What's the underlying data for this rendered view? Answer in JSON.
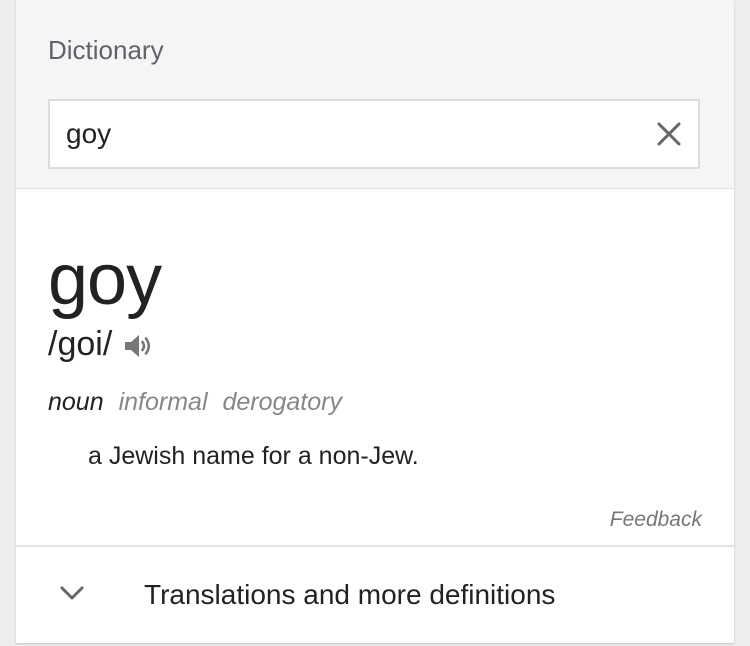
{
  "header": {
    "title": "Dictionary"
  },
  "search": {
    "value": "goy",
    "clear_icon": "close-icon"
  },
  "entry": {
    "word": "goy",
    "phonetic": "/goi/",
    "audio_icon": "speaker-icon",
    "part_of_speech": "noun",
    "labels": [
      "informal",
      "derogatory"
    ],
    "definition": "a Jewish name for a non-Jew."
  },
  "feedback_label": "Feedback",
  "more": {
    "label": "Translations and more definitions",
    "icon": "chevron-down-icon"
  },
  "colors": {
    "background": "#eeeeee",
    "header_background": "#f5f5f5",
    "text": "#222222",
    "muted": "#878787"
  }
}
